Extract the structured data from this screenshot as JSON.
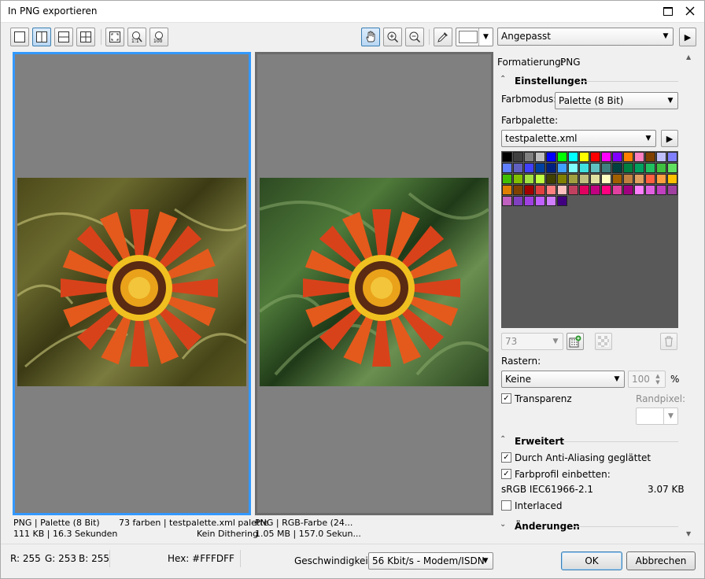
{
  "window": {
    "title": "In PNG exportieren"
  },
  "toolbar": {
    "view_buttons": [
      "single-view-icon",
      "split-vertical-view-icon",
      "split-horizontal-view-icon",
      "quad-view-icon"
    ],
    "zoom_mode": "Angepasst",
    "background_color": "#ffffff"
  },
  "preview_left": {
    "info_line1_left": "PNG  |  Palette (8 Bit)",
    "info_line1_right": "73 farben  |  testpalette.xml  palette",
    "info_line2_left": "111 KB  |  16.3 Sekunden",
    "info_line2_right": "Kein Dithering"
  },
  "preview_right": {
    "info_line1": "PNG  |  RGB-Farbe (24...",
    "info_line2": "1.05 MB  |  157.0 Sekun..."
  },
  "settings": {
    "format_label": "Formatierung:",
    "format_value": "PNG",
    "section_settings": "Einstellungen",
    "color_mode_label": "Farbmodus:",
    "color_mode_value": "Palette (8 Bit)",
    "palette_label": "Farbpalette:",
    "palette_value": "testpalette.xml",
    "color_count": "73",
    "dither_label": "Rastern:",
    "dither_value": "Keine",
    "dither_amount": "100",
    "percent": "%",
    "transparency_label": "Transparenz",
    "border_pixel_label": "Randpixel:",
    "section_advanced": "Erweitert",
    "antialias_label": "Durch Anti-Aliasing geglättet",
    "embed_profile_label": "Farbprofil einbetten:",
    "profile_name": "sRGB IEC61966-2.1",
    "profile_size": "3.07 KB",
    "interlaced_label": "Interlaced",
    "section_changes": "Änderungen"
  },
  "palette_colors": [
    "#000000",
    "#404040",
    "#808080",
    "#c0c0c0",
    "#0000ff",
    "#00ff00",
    "#00ffff",
    "#ffff00",
    "#ff0000",
    "#ff00ff",
    "#8000ff",
    "#ff8000",
    "#ff80c0",
    "#804000",
    "#c0c0ff",
    "#8080ff",
    "#6080ff",
    "#6060c0",
    "#4040ff",
    "#0040a0",
    "#002080",
    "#40a0ff",
    "#80ffff",
    "#40e0e0",
    "#60c0c0",
    "#408080",
    "#004040",
    "#008040",
    "#00a060",
    "#20c060",
    "#40c040",
    "#60e060",
    "#40c000",
    "#80c000",
    "#a0e040",
    "#c0ff40",
    "#404000",
    "#808000",
    "#a0a040",
    "#c0c080",
    "#e0e0a0",
    "#ffffc0",
    "#a06000",
    "#c08040",
    "#e0a060",
    "#ff6040",
    "#ffa040",
    "#ffc000",
    "#e08000",
    "#804000",
    "#a00000",
    "#e04040",
    "#ff8080",
    "#ffc0c0",
    "#c04060",
    "#e00060",
    "#c00080",
    "#ff0080",
    "#e040a0",
    "#a00080",
    "#ff80ff",
    "#e060e0",
    "#c040c0",
    "#a040a0",
    "#c060c0",
    "#8040c0",
    "#a040e0",
    "#c060ff",
    "#d080ff",
    "#400080"
  ],
  "statusbar": {
    "r": "R: 255",
    "g": "G: 253",
    "b": "B: 255",
    "hex": "Hex: #FFFDFF",
    "speed_label": "Geschwindigkeit:",
    "speed_value": "56 Kbit/s - Modem/ISDN",
    "ok": "OK",
    "cancel": "Abbrechen"
  }
}
